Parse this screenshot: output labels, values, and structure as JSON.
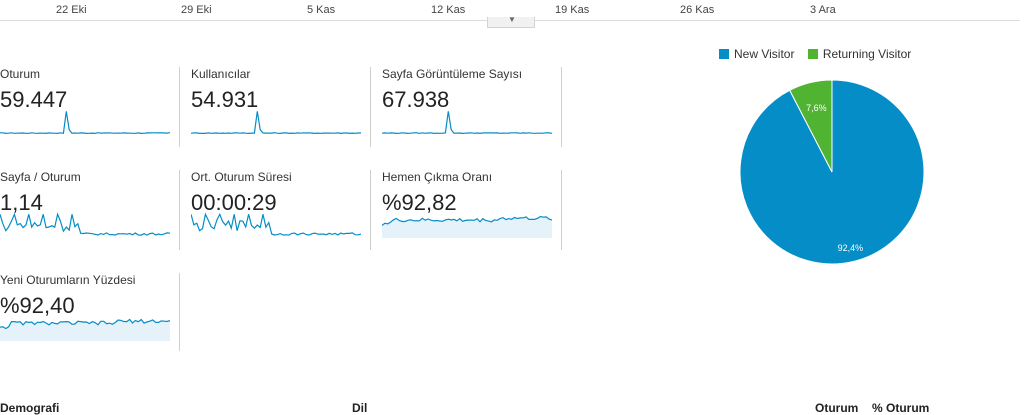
{
  "timeline": {
    "labels": [
      "22 Eki",
      "29 Eki",
      "5 Kas",
      "12 Kas",
      "19 Kas",
      "26 Kas",
      "3 Ara"
    ]
  },
  "metrics": [
    {
      "id": "oturum",
      "label": "Oturum",
      "value": "59.447",
      "spark": "spike"
    },
    {
      "id": "kullanicilar",
      "label": "Kullanıcılar",
      "value": "54.931",
      "spark": "spike"
    },
    {
      "id": "sayfa-goruntuleme",
      "label": "Sayfa Görüntüleme Sayısı",
      "value": "67.938",
      "spark": "spike"
    },
    {
      "id": "sayfa-oturum",
      "label": "Sayfa / Oturum",
      "value": "1,14",
      "spark": "noisy"
    },
    {
      "id": "ort-oturum-suresi",
      "label": "Ort. Oturum Süresi",
      "value": "00:00:29",
      "spark": "noisy"
    },
    {
      "id": "hemen-cikma",
      "label": "Hemen Çıkma Oranı",
      "value": "%92,82",
      "spark": "high"
    },
    {
      "id": "yeni-oturum-yuzdesi",
      "label": "Yeni Oturumların Yüzdesi",
      "value": "%92,40",
      "spark": "high"
    }
  ],
  "chart_data": {
    "type": "pie",
    "slices": [
      {
        "name": "New Visitor",
        "value": 92.4,
        "label": "92,4%",
        "color": "#058dc7"
      },
      {
        "name": "Returning Visitor",
        "value": 7.6,
        "label": "7,6%",
        "color": "#50b432"
      }
    ],
    "legend": "top"
  },
  "colors": {
    "spark_line": "#058dc7",
    "spark_fill": "#e6f2fa"
  },
  "bottom": {
    "left": "Demografi",
    "mid": "Dil",
    "col1": "Oturum",
    "col2": "% Oturum"
  }
}
